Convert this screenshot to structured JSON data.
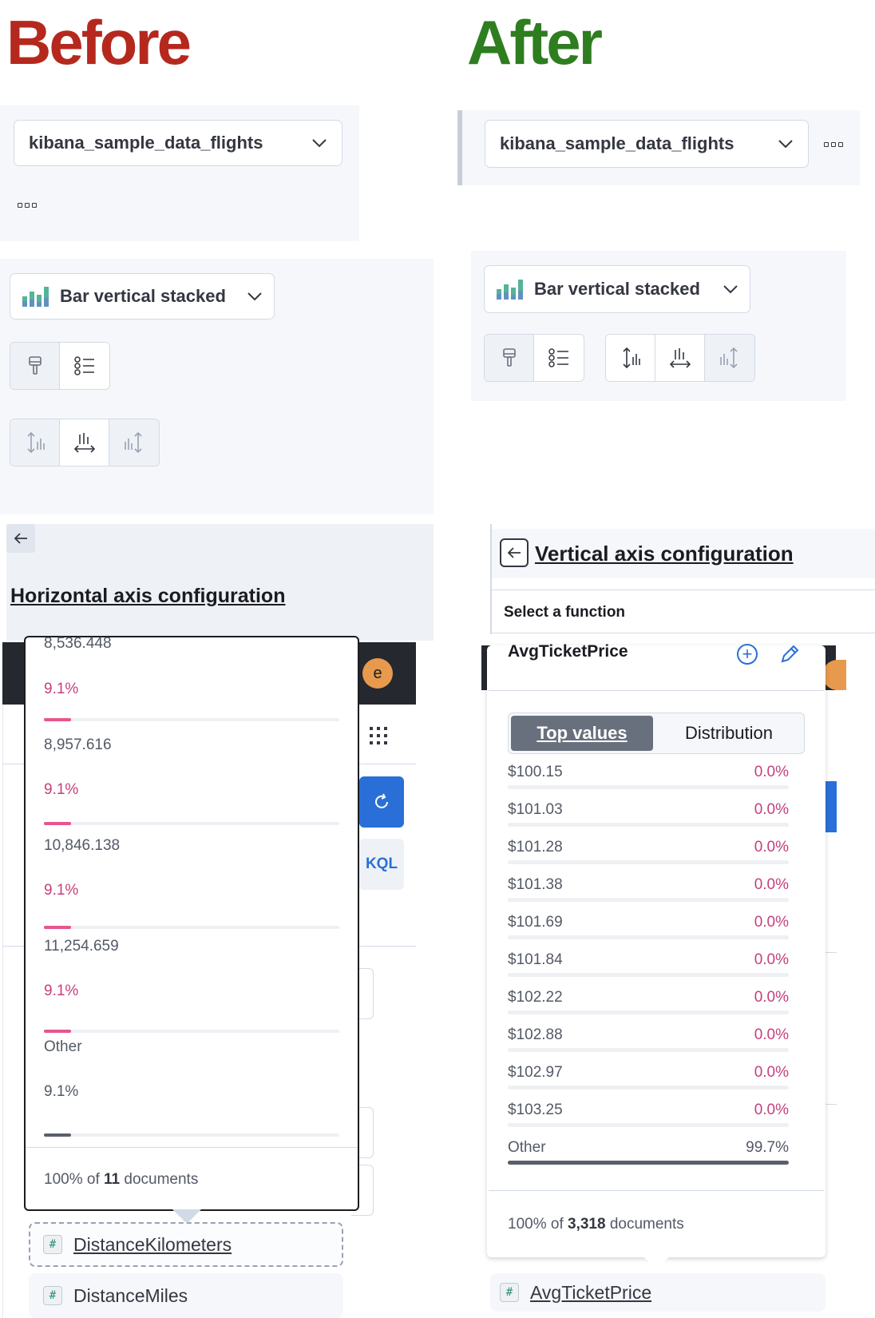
{
  "before": {
    "heading": "Before",
    "heading_color": "#b5281e",
    "index_select": "kibana_sample_data_flights",
    "chart_select": "Bar vertical stacked",
    "section_title": "Horizontal axis configuration",
    "avatar_letter": "e",
    "kql_label": "KQL",
    "rows": [
      {
        "value": "8,536.448",
        "pct": ""
      },
      {
        "value": "",
        "pct": "9.1%"
      },
      {
        "value": "8,957.616",
        "pct": "9.1%"
      },
      {
        "value": "10,846.138",
        "pct": "9.1%"
      },
      {
        "value": "11,254.659",
        "pct": "9.1%"
      },
      {
        "value": "Other",
        "pct": "9.1%"
      }
    ],
    "footer_prefix": "100% of ",
    "footer_count": "11",
    "footer_suffix": " documents",
    "fields": [
      "DistanceKilometers",
      "DistanceMiles"
    ]
  },
  "after": {
    "heading": "After",
    "heading_color": "#2e7d1f",
    "index_select": "kibana_sample_data_flights",
    "chart_select": "Bar vertical stacked",
    "section_title": "Vertical axis configuration",
    "select_function": "Select a function",
    "field_title": "AvgTicketPrice",
    "tabs": [
      "Top values",
      "Distribution"
    ],
    "rows": [
      {
        "value": "$100.15",
        "pct": "0.0%"
      },
      {
        "value": "$101.03",
        "pct": "0.0%"
      },
      {
        "value": "$101.28",
        "pct": "0.0%"
      },
      {
        "value": "$101.38",
        "pct": "0.0%"
      },
      {
        "value": "$101.69",
        "pct": "0.0%"
      },
      {
        "value": "$101.84",
        "pct": "0.0%"
      },
      {
        "value": "$102.22",
        "pct": "0.0%"
      },
      {
        "value": "$102.88",
        "pct": "0.0%"
      },
      {
        "value": "$102.97",
        "pct": "0.0%"
      },
      {
        "value": "$103.25",
        "pct": "0.0%"
      },
      {
        "value": "Other",
        "pct": "99.7%"
      }
    ],
    "footer_prefix": "100% of ",
    "footer_count": "3,318",
    "footer_suffix": " documents",
    "field": "AvgTicketPrice"
  },
  "colors": {
    "pink_bar": "#e7558d",
    "dark_bar": "#5a5f6b",
    "accent_blue": "#2a6fd8",
    "avatar_orange": "#e79a4d"
  }
}
